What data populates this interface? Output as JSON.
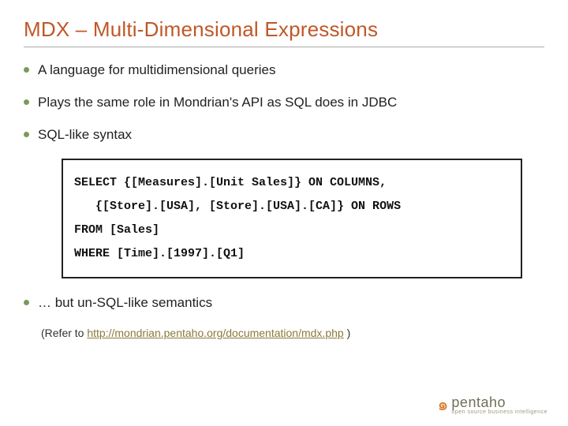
{
  "title": "MDX – Multi-Dimensional Expressions",
  "bullets_top": [
    "A language for multidimensional queries",
    "Plays the same role in Mondrian's API as SQL does in JDBC",
    "SQL-like syntax"
  ],
  "code": "SELECT {[Measures].[Unit Sales]} ON COLUMNS,\n   {[Store].[USA], [Store].[USA].[CA]} ON ROWS\nFROM [Sales]\nWHERE [Time].[1997].[Q1]",
  "bullets_bottom": [
    "… but un-SQL-like semantics"
  ],
  "refer_prefix": "(Refer to ",
  "refer_link_text": "http://mondrian.pentaho.org/documentation/mdx.php",
  "refer_suffix": " )",
  "logo": {
    "brand": "pentaho",
    "tagline": "open source business intelligence"
  }
}
